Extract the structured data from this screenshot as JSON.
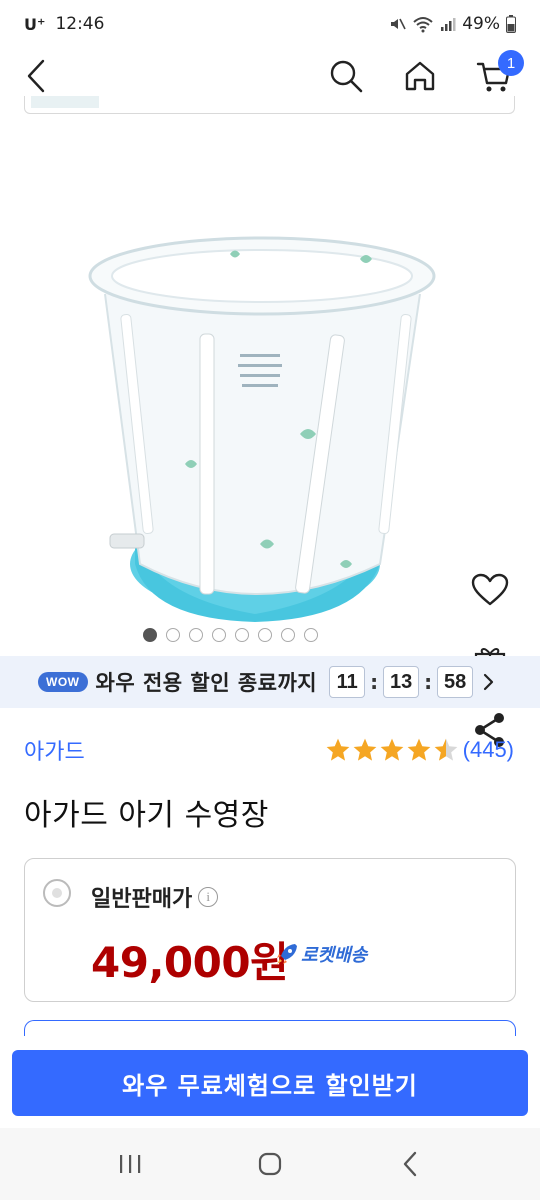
{
  "status_bar": {
    "carrier": "U⁺",
    "time": "12:46",
    "battery": "49%",
    "icons": [
      "mute-icon",
      "wifi-icon",
      "signal-icon",
      "battery-icon"
    ]
  },
  "header": {
    "back_icon": "chevron-left-icon",
    "search_icon": "search-icon",
    "home_icon": "home-icon",
    "cart_icon": "cart-icon",
    "cart_count": "1"
  },
  "gallery": {
    "total_images": 8,
    "active_index": 0,
    "side_actions": [
      "heart-icon",
      "gift-icon",
      "share-icon"
    ]
  },
  "wow_banner": {
    "badge": "WOW",
    "text": "와우 전용 할인 종료까지",
    "hours": "11",
    "minutes": "13",
    "seconds": "58"
  },
  "product": {
    "brand": "아가드",
    "rating": 4.5,
    "review_count": "(445)",
    "title": "아가드 아기 수영장"
  },
  "price_option": {
    "label": "일반판매가",
    "info_icon": "i",
    "price": "49,000원",
    "delivery": "로켓배송"
  },
  "cta": {
    "label": "와우 무료체험으로 할인받기"
  },
  "colors": {
    "accent": "#346aff",
    "price": "#ae0000",
    "star": "#f5a623",
    "wow_bg": "#edf2fb"
  }
}
